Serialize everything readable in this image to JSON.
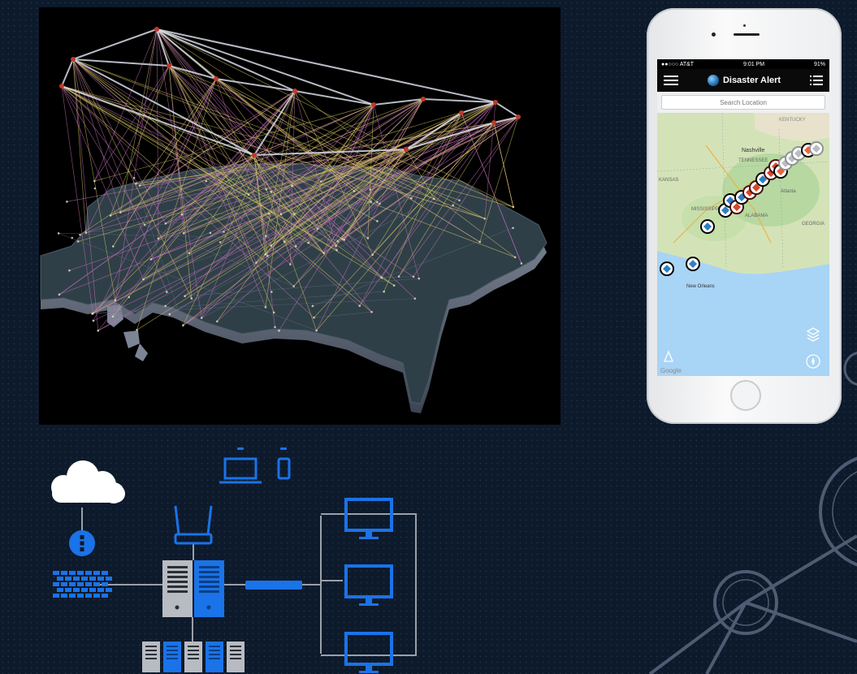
{
  "phone": {
    "status": {
      "carrier": "●●○○○ AT&T",
      "time": "9:01 PM",
      "battery": "91%"
    },
    "app_title": "Disaster Alert",
    "search": {
      "placeholder": "Search Location"
    },
    "map_labels": [
      "Nashville",
      "TENNESSEE",
      "KANSAS",
      "MISSISSIPPI",
      "ALABAMA",
      "Atlanta",
      "GEORGIA",
      "New Orleans",
      "KENTUCKY",
      "Google"
    ]
  },
  "colors": {
    "background": "#0d1a2c",
    "network_blue": "#1a73e8",
    "map_land": "#2f3f48",
    "connection_pink": "#c46fb6",
    "connection_yellow": "#d6c760"
  },
  "icons": [
    "cloud-icon",
    "firewall-icon",
    "router-icon",
    "server-icon",
    "switch-icon",
    "monitor-icon",
    "laptop-icon",
    "smartphone-icon",
    "hamburger-icon",
    "list-icon",
    "layers-icon",
    "compass-icon"
  ]
}
